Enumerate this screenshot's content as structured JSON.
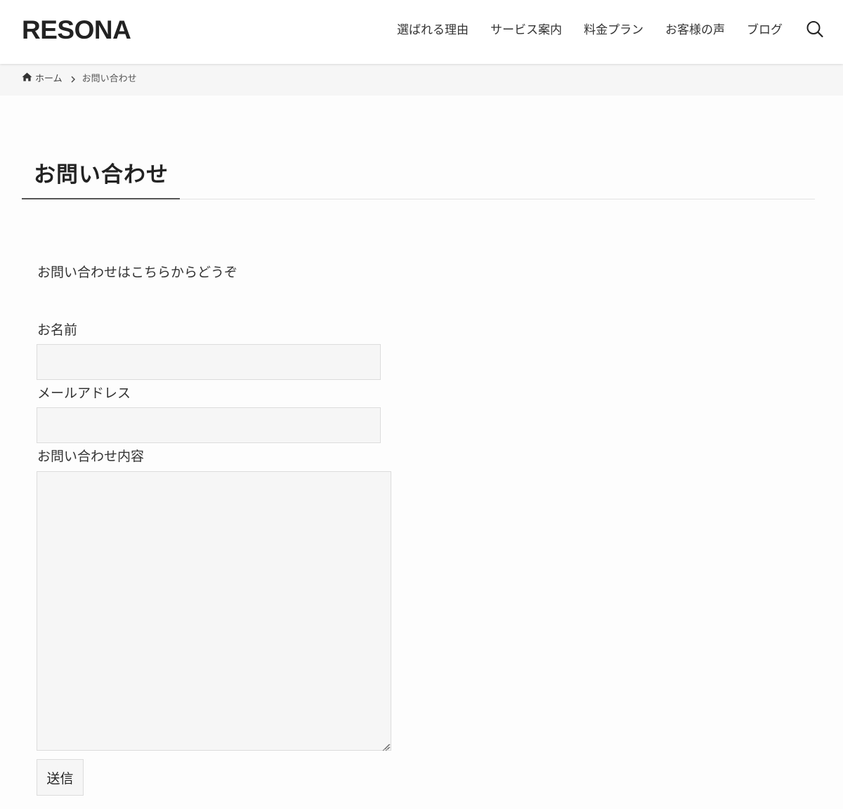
{
  "header": {
    "logo": "RESONA",
    "nav": [
      {
        "label": "選ばれる理由"
      },
      {
        "label": "サービス案内"
      },
      {
        "label": "料金プラン"
      },
      {
        "label": "お客様の声"
      },
      {
        "label": "ブログ"
      }
    ],
    "search_icon": "search-icon"
  },
  "breadcrumb": {
    "home_icon": "home-icon",
    "home_label": "ホーム",
    "separator_icon": "chevron-right-icon",
    "current": "お問い合わせ"
  },
  "page": {
    "title": "お問い合わせ",
    "intro": "お問い合わせはこちらからどうぞ"
  },
  "form": {
    "name_label": "お名前",
    "name_value": "",
    "email_label": "メールアドレス",
    "email_value": "",
    "message_label": "お問い合わせ内容",
    "message_value": "",
    "submit_label": "送信"
  },
  "colors": {
    "header_bg": "#ffffff",
    "breadcrumb_bg": "#f6f6f6",
    "field_bg": "#f6f6f6",
    "text": "#333333"
  }
}
